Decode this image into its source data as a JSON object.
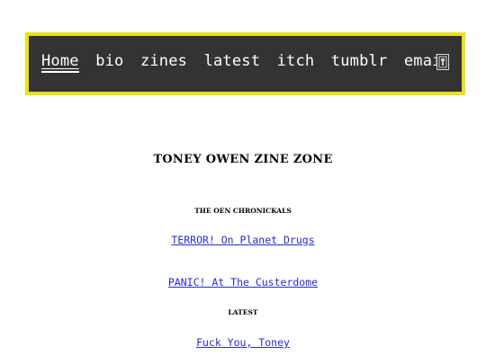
{
  "nav": {
    "items": [
      {
        "label": "Home",
        "active": true
      },
      {
        "label": "bio"
      },
      {
        "label": "zines"
      },
      {
        "label": "latest"
      },
      {
        "label": "itch"
      },
      {
        "label": "tumblr"
      },
      {
        "label": "email"
      }
    ],
    "menu_icon": "hamburger-menu-icon",
    "colors": {
      "bar": "#333333",
      "border": "#e9e21b",
      "text": "#ffffff"
    }
  },
  "main": {
    "title": "TONEY OWEN ZINE ZONE",
    "chronicles_heading": "THE OEN CHRONICKALS",
    "zine_link_1": "TERROR! On Planet Drugs",
    "zine_link_2": "PANIC! At The Custerdome",
    "latest_heading": "LATEST",
    "latest_link": "Fuck You, Toney",
    "link_color": "#2a2ad4"
  }
}
